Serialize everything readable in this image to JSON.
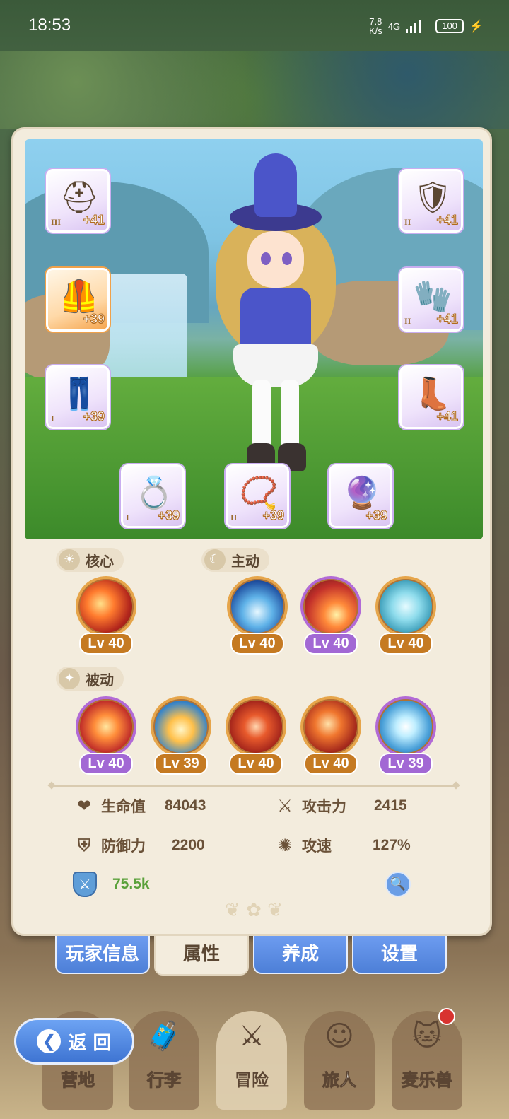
{
  "status_bar": {
    "time": "18:53",
    "net_speed_value": "7.8",
    "net_speed_unit": "K/s",
    "network_type": "4G",
    "battery": "100"
  },
  "equipment": {
    "left_slots": [
      {
        "icon": "helmet-icon",
        "tier": "III",
        "plus": "+41",
        "rarity": "purple"
      },
      {
        "icon": "chest-armor-icon",
        "tier": "",
        "plus": "+39",
        "rarity": "orange"
      },
      {
        "icon": "pants-icon",
        "tier": "I",
        "plus": "+39",
        "rarity": "purple"
      }
    ],
    "right_slots": [
      {
        "icon": "crest-icon",
        "tier": "II",
        "plus": "+41",
        "rarity": "purple"
      },
      {
        "icon": "gauntlet-icon",
        "tier": "II",
        "plus": "+41",
        "rarity": "purple"
      },
      {
        "icon": "boots-icon",
        "tier": "",
        "plus": "+41",
        "rarity": "purple"
      }
    ],
    "bottom_slots": [
      {
        "icon": "ring-icon",
        "tier": "I",
        "plus": "+39",
        "rarity": "purple"
      },
      {
        "icon": "necklace-icon",
        "tier": "II",
        "plus": "+39",
        "rarity": "purple"
      },
      {
        "icon": "charm-icon",
        "tier": "",
        "plus": "+39",
        "rarity": "purple"
      }
    ]
  },
  "skills": {
    "core_label": "核心",
    "active_label": "主动",
    "passive_label": "被动",
    "core": [
      {
        "icon": "fireball-skill-icon",
        "level": "Lv 40",
        "color": "orange"
      }
    ],
    "active": [
      {
        "icon": "ice-spike-skill-icon",
        "level": "Lv 40",
        "color": "orange"
      },
      {
        "icon": "meteor-skill-icon",
        "level": "Lv 40",
        "color": "purple"
      },
      {
        "icon": "whirlwind-skill-icon",
        "level": "Lv 40",
        "color": "orange"
      }
    ],
    "passive": [
      {
        "icon": "fire-vortex-skill-icon",
        "level": "Lv 40",
        "color": "purple"
      },
      {
        "icon": "flame-orb-skill-icon",
        "level": "Lv 39",
        "color": "orange"
      },
      {
        "icon": "ember-crystal-skill-icon",
        "level": "Lv 40",
        "color": "orange"
      },
      {
        "icon": "fire-slash-skill-icon",
        "level": "Lv 40",
        "color": "orange"
      },
      {
        "icon": "lightning-skill-icon",
        "level": "Lv 39",
        "color": "purple"
      }
    ]
  },
  "stats": {
    "hp_label": "生命值",
    "hp_value": "84043",
    "attack_label": "攻击力",
    "attack_value": "2415",
    "defense_label": "防御力",
    "defense_value": "2200",
    "attack_speed_label": "攻速",
    "attack_speed_value": "127%",
    "power_value": "75.5k"
  },
  "tabs": [
    {
      "label": "玩家信息",
      "active": false
    },
    {
      "label": "属性",
      "active": true
    },
    {
      "label": "养成",
      "active": false
    },
    {
      "label": "设置",
      "active": false
    }
  ],
  "bottom_nav": {
    "back_label": "返 回",
    "items": [
      {
        "label": "营地",
        "icon": "camp-icon"
      },
      {
        "label": "行李",
        "icon": "bag-icon"
      },
      {
        "label": "冒险",
        "icon": "crossed-swords-icon"
      },
      {
        "label": "旅人",
        "icon": "traveler-icon"
      },
      {
        "label": "麦乐兽",
        "icon": "pet-icon"
      }
    ]
  },
  "colors": {
    "card_bg": "#f3ecdd",
    "tab_blue": "#4d7fd7",
    "orange_level": "#c57a22",
    "purple_level": "#a268d4",
    "power_green": "#5aa13a"
  }
}
